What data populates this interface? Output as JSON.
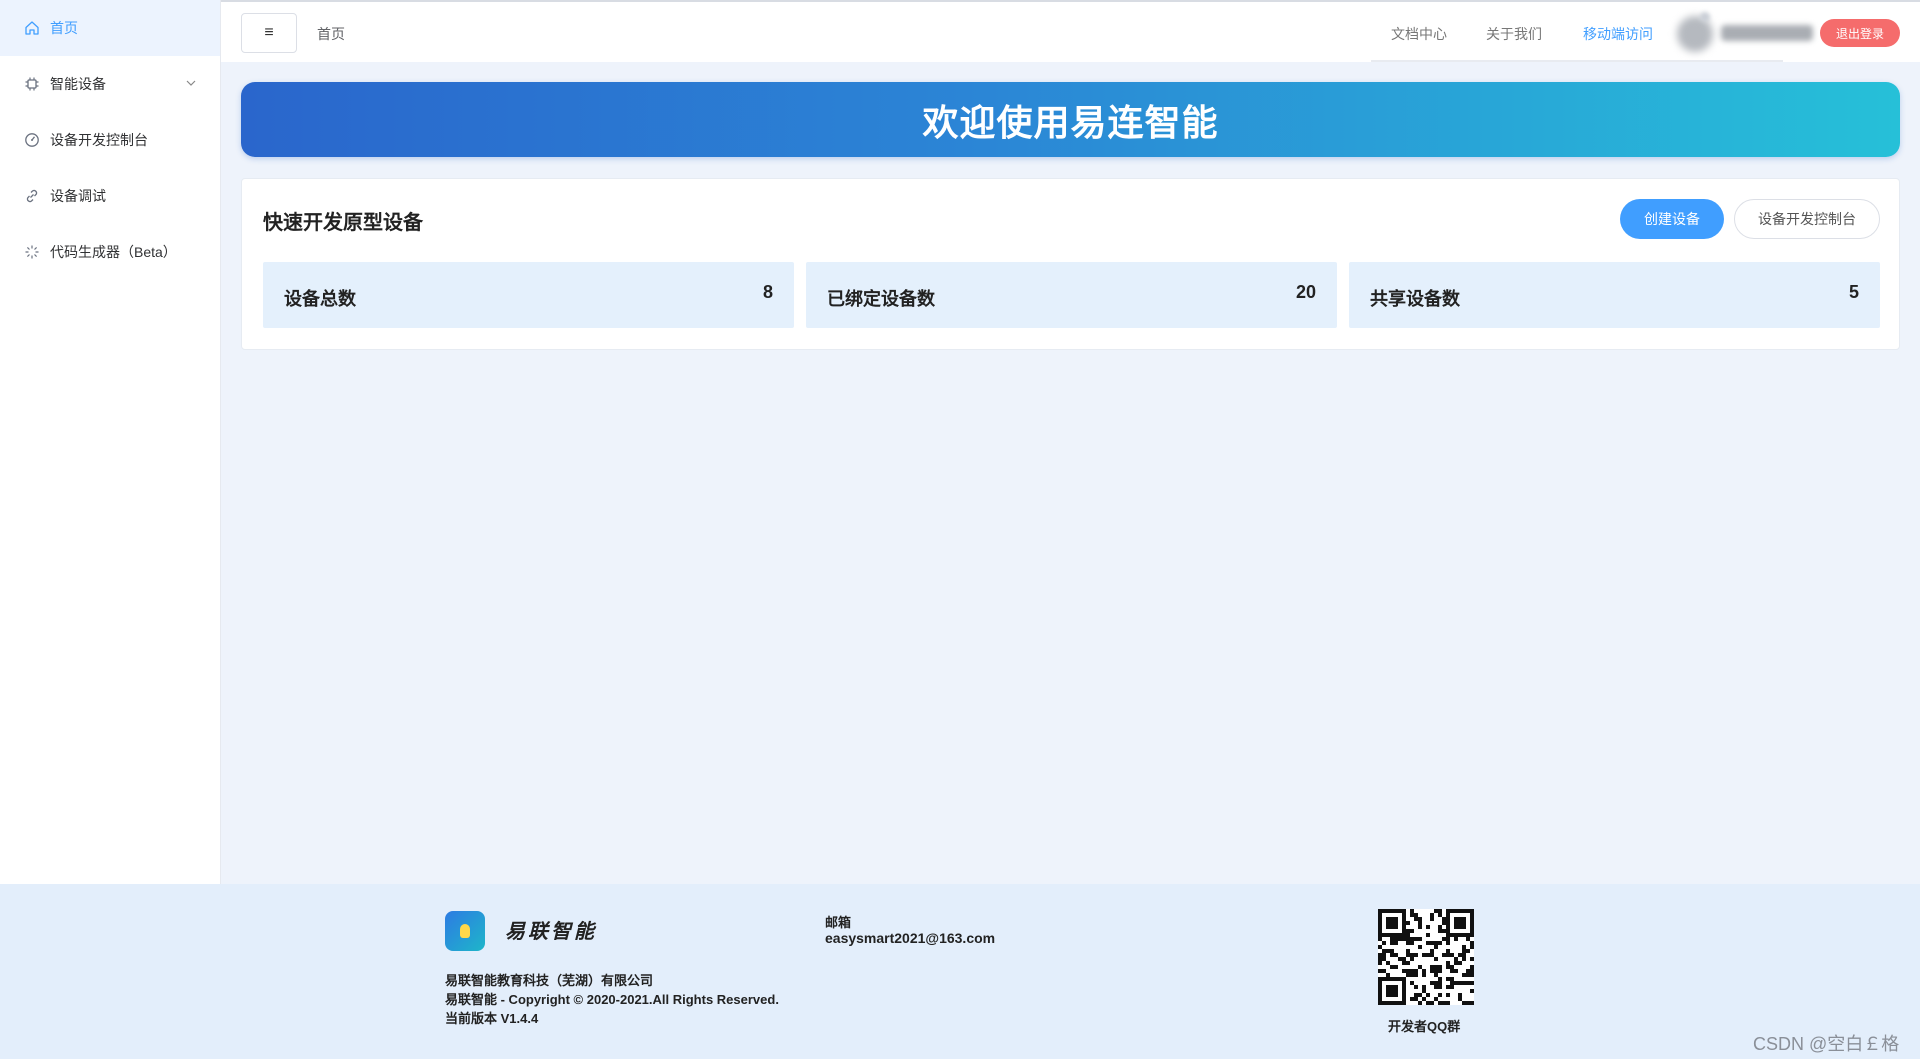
{
  "sidebar": {
    "items": [
      {
        "label": "首页",
        "icon": "home-icon",
        "active": true
      },
      {
        "label": "智能设备",
        "icon": "chip-icon",
        "expandable": true
      },
      {
        "label": "设备开发控制台",
        "icon": "dashboard-icon"
      },
      {
        "label": "设备调试",
        "icon": "link-icon"
      },
      {
        "label": "代码生成器（Beta）",
        "icon": "loading-icon"
      }
    ]
  },
  "header": {
    "menu_toggle_icon": "≡",
    "breadcrumb": "首页",
    "links": {
      "docs": "文档中心",
      "about": "关于我们",
      "mobile": "移动端访问"
    },
    "logout_label": "退出登录"
  },
  "banner": {
    "title": "欢迎使用易连智能"
  },
  "card": {
    "title": "快速开发原型设备",
    "create_button": "创建设备",
    "console_button": "设备开发控制台",
    "stats": [
      {
        "label": "设备总数",
        "value": "8"
      },
      {
        "label": "已绑定设备数",
        "value": "20"
      },
      {
        "label": "共享设备数",
        "value": "5"
      }
    ]
  },
  "footer": {
    "brand": "易联智能",
    "company": "易联智能教育科技（芜湖）有限公司",
    "copyright": "易联智能 - Copyright © 2020-2021.All Rights Reserved.",
    "version": "当前版本 V1.4.4",
    "email_label": "邮箱",
    "email": "easysmart2021@163.com",
    "qr_label": "开发者QQ群",
    "watermark": "CSDN @空白￡格"
  },
  "colors": {
    "primary": "#409eff",
    "danger": "#f56c6c",
    "banner_start": "#2a66cc",
    "banner_end": "#26c0d8",
    "stat_bg": "#e4f0fc"
  }
}
